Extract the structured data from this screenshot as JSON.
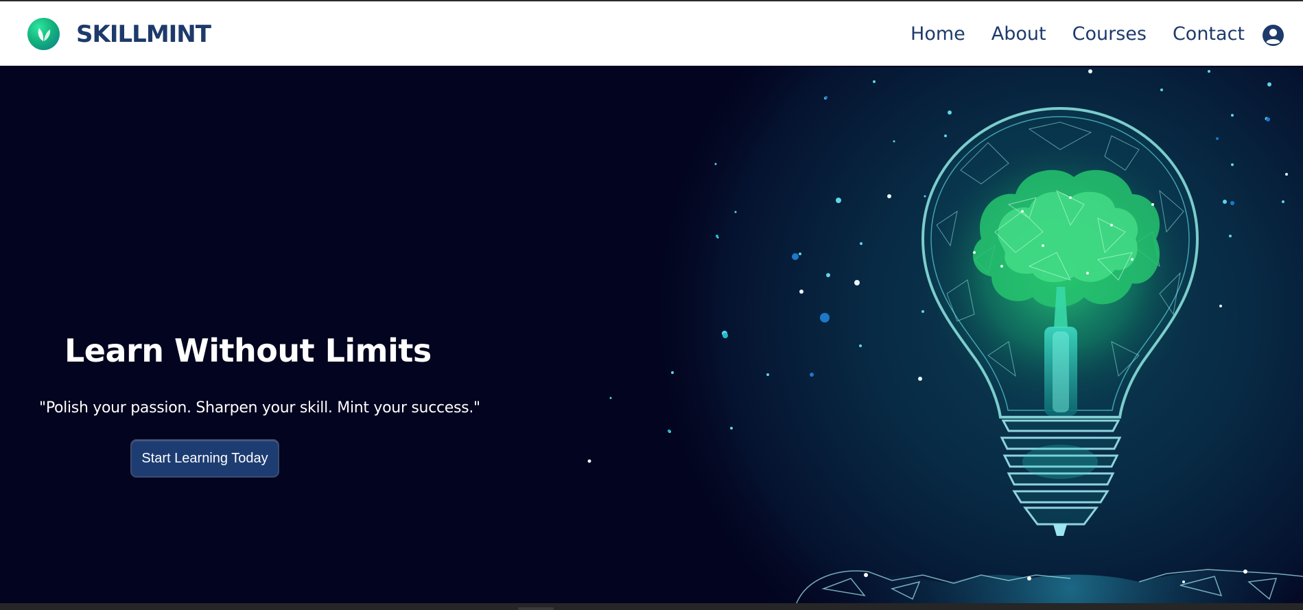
{
  "header": {
    "brand": "SKILLMINT",
    "nav": [
      {
        "label": "Home"
      },
      {
        "label": "About"
      },
      {
        "label": "Courses"
      },
      {
        "label": "Contact"
      }
    ],
    "icons": {
      "logo": "leaf-logo-icon",
      "account": "user-circle-icon"
    }
  },
  "hero": {
    "title": "Learn Without Limits",
    "tagline": "\"Polish your passion. Sharpen your skill. Mint your success.\"",
    "cta_label": "Start Learning Today",
    "image": "lightbulb-tree-illustration"
  },
  "colors": {
    "brand_navy": "#1d3a6b",
    "hero_background": "#03041f",
    "button": "#1d3c72",
    "accent_green": "#2ee6a0"
  }
}
